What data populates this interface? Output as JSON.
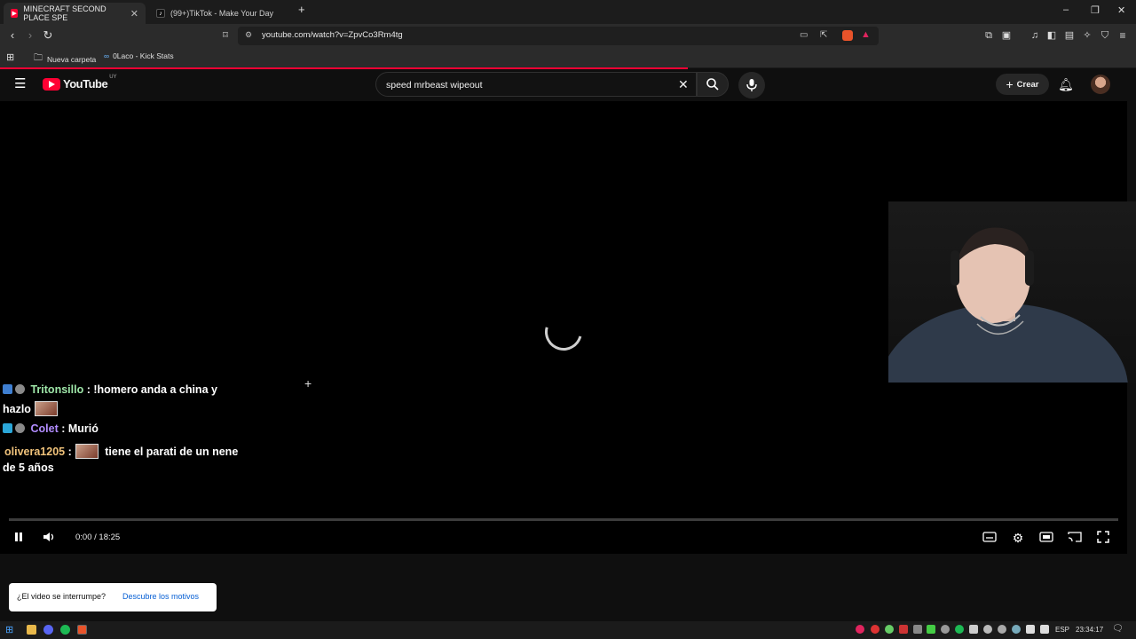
{
  "browser": {
    "tabs": [
      {
        "title": "MINECRAFT SECOND PLACE SPE"
      },
      {
        "title": "(99+)TikTok - Make Your Day"
      }
    ],
    "url": "youtube.com/watch?v=ZpvCo3Rm4tg",
    "bookmarks": [
      {
        "label": "Nueva carpeta"
      },
      {
        "label": "0Laco - Kick Stats"
      }
    ]
  },
  "youtube": {
    "logo_text": "YouTube",
    "region": "UY",
    "search_query": "speed mrbeast wipeout",
    "create_label": "Crear"
  },
  "player": {
    "time": "0:00 / 18:25",
    "progress_fraction": 0.0
  },
  "chat": [
    {
      "user": "Tritonsillo",
      "text_before": "!homero anda a china y",
      "text_after": "hazlo"
    },
    {
      "user": "Colet",
      "text": "Murió"
    },
    {
      "user": "olivera1205",
      "text": "tiene el parati de un nene",
      "text2": "de 5 años"
    }
  ],
  "notice": {
    "question": "¿El video se interrumpe?",
    "link": "Descubre los motivos"
  },
  "taskbar": {
    "lang": "ESP",
    "clock": "23:34:17"
  },
  "colors": {
    "accent": "#ff0033",
    "chat_user_1": "#9ee6a8",
    "chat_user_2": "#b28cff",
    "chat_user_3": "#f0c27a"
  }
}
